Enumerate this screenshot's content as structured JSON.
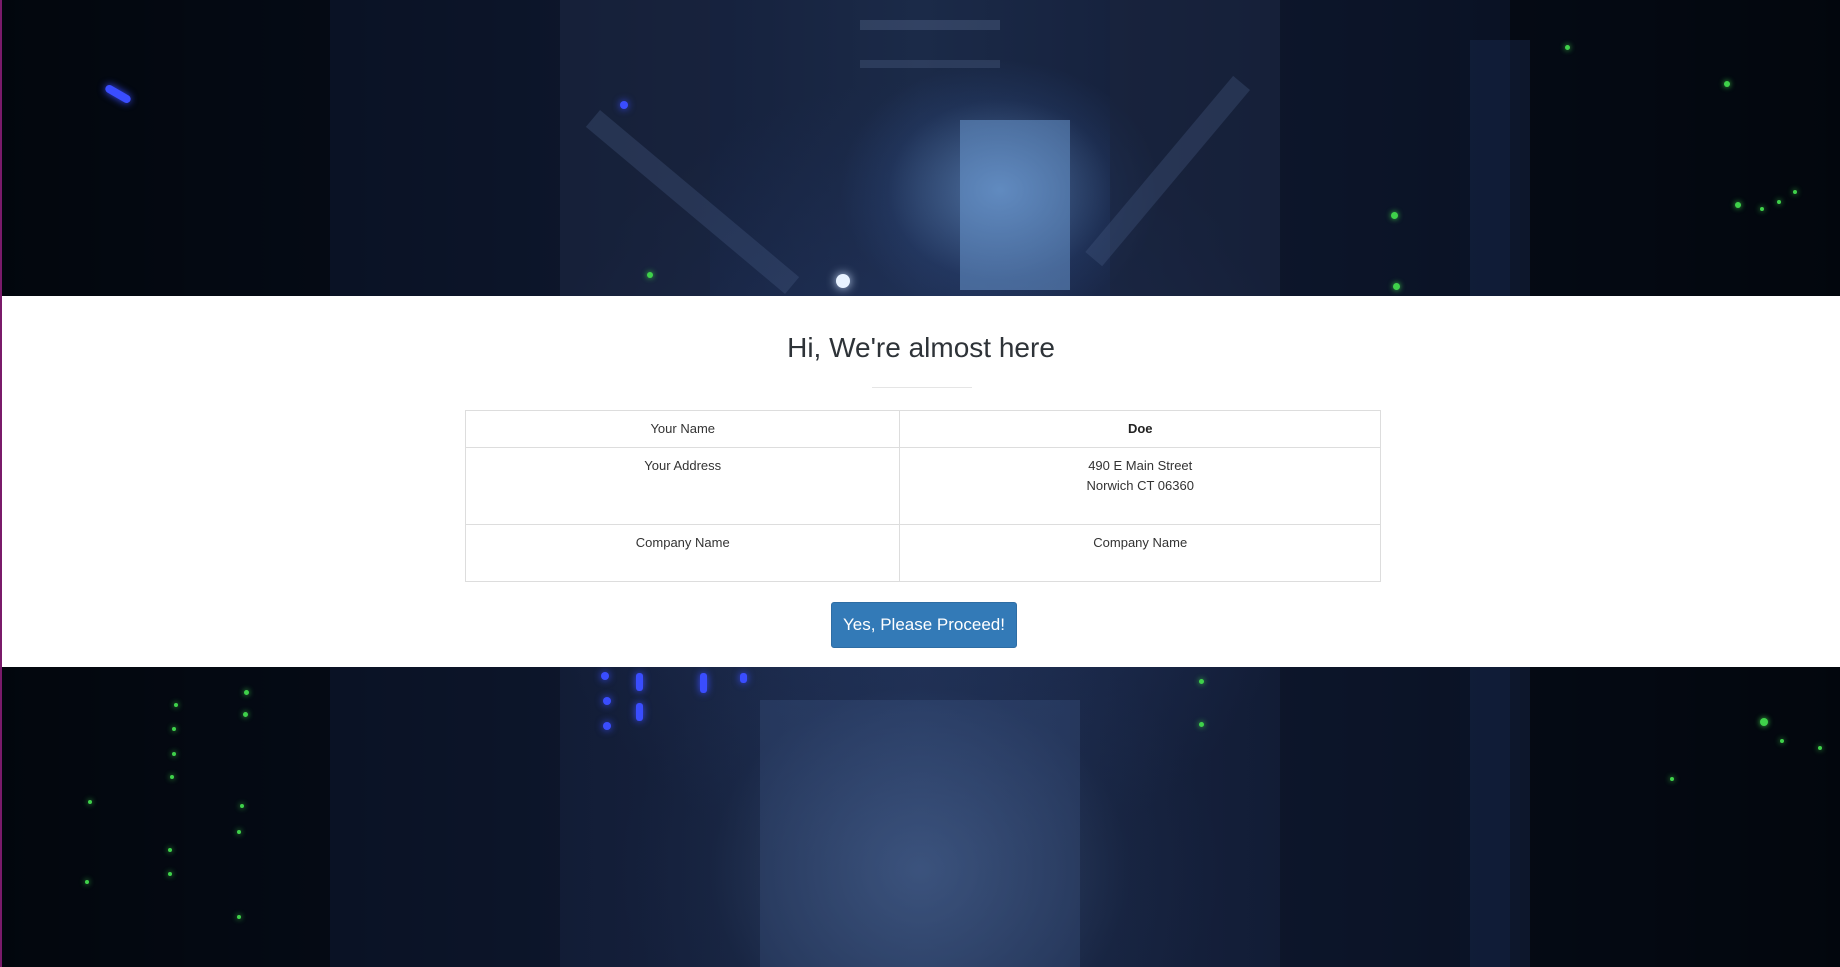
{
  "page": {
    "heading": "Hi, We're almost here",
    "accent_color": "#337ab7"
  },
  "details": {
    "rows": [
      {
        "label": "Your Name",
        "value_lines": [
          "Doe"
        ]
      },
      {
        "label": "Your Address",
        "value_lines": [
          "490 E Main Street",
          "Norwich CT 06360"
        ]
      },
      {
        "label": "Company Name",
        "value_lines": [
          "Company Name"
        ]
      }
    ]
  },
  "actions": {
    "proceed_label": "Yes, Please Proceed!"
  }
}
